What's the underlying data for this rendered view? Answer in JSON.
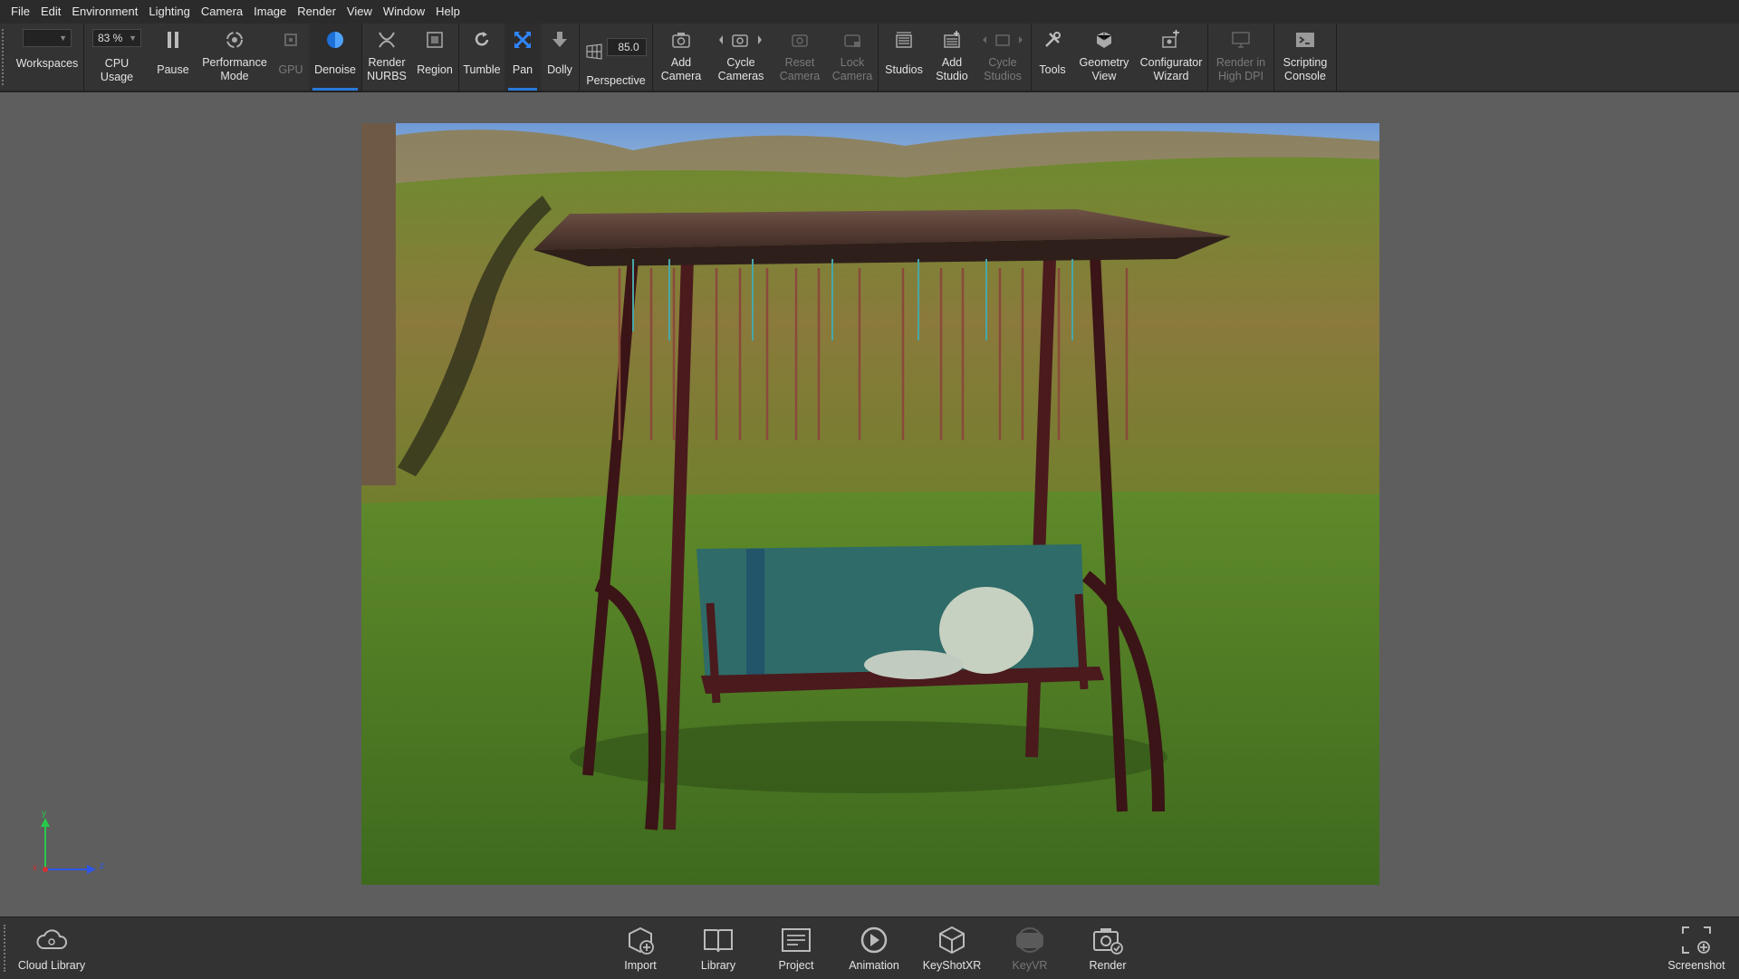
{
  "menu": [
    "File",
    "Edit",
    "Environment",
    "Lighting",
    "Camera",
    "Image",
    "Render",
    "View",
    "Window",
    "Help"
  ],
  "ribbon": {
    "workspaces_label": "Workspaces",
    "cpu_value": "83 %",
    "cpu_label": "CPU Usage",
    "pause_label": "Pause",
    "performance_label": "Performance\nMode",
    "gpu_label": "GPU",
    "denoise_label": "Denoise",
    "render_nurbs_label": "Render\nNURBS",
    "region_label": "Region",
    "tumble_label": "Tumble",
    "pan_label": "Pan",
    "dolly_label": "Dolly",
    "perspective_value": "85.0",
    "perspective_label": "Perspective",
    "add_camera_label": "Add\nCamera",
    "cycle_cameras_label": "Cycle\nCameras",
    "reset_camera_label": "Reset\nCamera",
    "lock_camera_label": "Lock\nCamera",
    "studios_label": "Studios",
    "add_studio_label": "Add\nStudio",
    "cycle_studios_label": "Cycle\nStudios",
    "tools_label": "Tools",
    "geometry_view_label": "Geometry\nView",
    "configurator_label": "Configurator\nWizard",
    "high_dpi_label": "Render in\nHigh DPI",
    "scripting_label": "Scripting\nConsole"
  },
  "gizmo": {
    "y": "y",
    "z": "z",
    "x": "x"
  },
  "dock": {
    "cloud_library": "Cloud Library",
    "import": "Import",
    "library": "Library",
    "project": "Project",
    "animation": "Animation",
    "keyshotxr": "KeyShotXR",
    "keyvr": "KeyVR",
    "render": "Render",
    "screenshot": "Screenshot"
  },
  "colors": {
    "accent": "#2b79d9",
    "toolbar_bg": "#333333",
    "menubar_bg": "#2b2b2b",
    "canvas_bg": "#5e5e5e"
  },
  "scene": {
    "description_icon": "garden-swing-render"
  }
}
